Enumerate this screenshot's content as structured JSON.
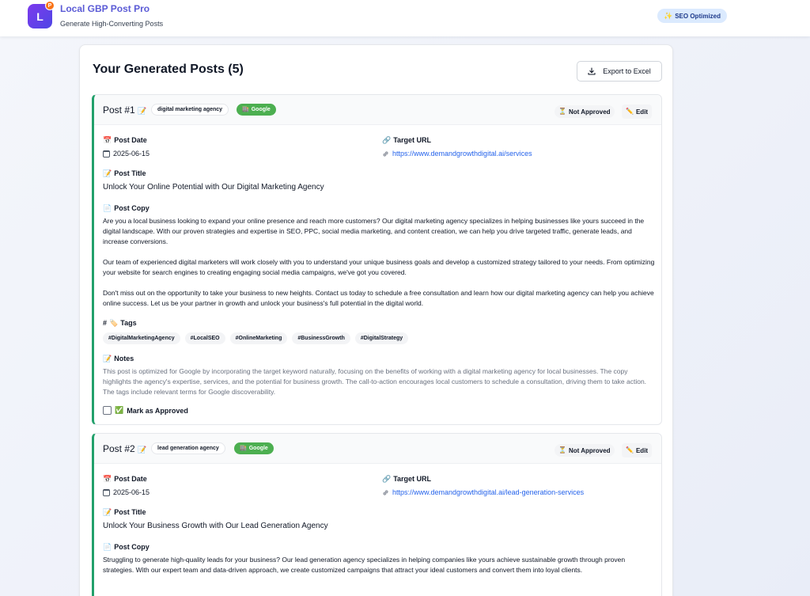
{
  "header": {
    "logo_letter": "L",
    "logo_badge": "P",
    "app_title": "Local GBP Post Pro",
    "app_subtitle": "Generate High-Converting Posts",
    "seo_badge": "SEO Optimized",
    "seo_badge_icon": "sparkle-icon"
  },
  "main": {
    "title": "Your Generated Posts (5)",
    "export_label": "Export to Excel",
    "export_icon": "download-icon"
  },
  "labels": {
    "post_date": "Post Date",
    "target_url": "Target URL",
    "post_title": "Post Title",
    "post_copy": "Post Copy",
    "tags": "Tags",
    "notes": "Notes",
    "mark_approved": "Mark as Approved",
    "not_approved": "Not Approved",
    "edit": "Edit",
    "platform": "Google"
  },
  "posts": [
    {
      "number": "Post #1",
      "keyword": "digital marketing agency",
      "date": "2025-06-15",
      "url": "https://www.demandgrowthdigital.ai/services",
      "title": "Unlock Your Online Potential with Our Digital Marketing Agency",
      "copy": [
        "Are you a local business looking to expand your online presence and reach more customers? Our digital marketing agency specializes in helping businesses like yours succeed in the digital landscape. With our proven strategies and expertise in SEO, PPC, social media marketing, and content creation, we can help you drive targeted traffic, generate leads, and increase conversions.",
        "Our team of experienced digital marketers will work closely with you to understand your unique business goals and develop a customized strategy tailored to your needs. From optimizing your website for search engines to creating engaging social media campaigns, we've got you covered.",
        "Don't miss out on the opportunity to take your business to new heights. Contact us today to schedule a free consultation and learn how our digital marketing agency can help you achieve online success. Let us be your partner in growth and unlock your business's full potential in the digital world."
      ],
      "tags": [
        "#DigitalMarketingAgency",
        "#LocalSEO",
        "#OnlineMarketing",
        "#BusinessGrowth",
        "#DigitalStrategy"
      ],
      "notes": "This post is optimized for Google by incorporating the target keyword naturally, focusing on the benefits of working with a digital marketing agency for local businesses. The copy highlights the agency's expertise, services, and the potential for business growth. The call-to-action encourages local customers to schedule a consultation, driving them to take action. The tags include relevant terms for Google discoverability.",
      "approved": false
    },
    {
      "number": "Post #2",
      "keyword": "lead generation agency",
      "date": "2025-06-15",
      "url": "https://www.demandgrowthdigital.ai/lead-generation-services",
      "title": "Unlock Your Business Growth with Our Lead Generation Agency",
      "copy": [
        "Struggling to generate high-quality leads for your business? Our lead generation agency specializes in helping companies like yours achieve sustainable growth through proven strategies. With our expert team and data-driven approach, we create customized campaigns that attract your ideal customers and convert them into loyal clients."
      ],
      "approved": false
    }
  ],
  "colors": {
    "brand": "#5b5bd6",
    "accent_green": "#22a06b",
    "google_chip": "#4caf50",
    "link": "#2563eb"
  }
}
